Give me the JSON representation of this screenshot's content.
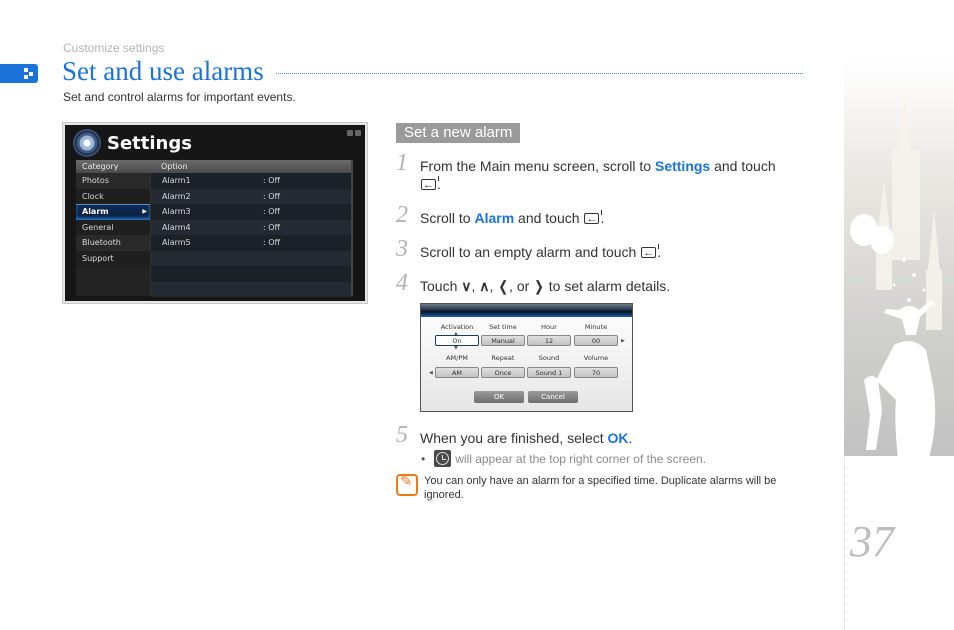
{
  "breadcrumb": "Customize settings",
  "title": "Set and use alarms",
  "subtitle": "Set and control alarms for important events.",
  "colors": {
    "accent": "#1a73d9",
    "note": "#ec7b1e",
    "badge": "#9a9a9a"
  },
  "settings_screen": {
    "title": "Settings",
    "category_header": "Category",
    "option_header": "Option",
    "categories": [
      "Photos",
      "Clock",
      "Alarm",
      "General",
      "Bluetooth",
      "Support"
    ],
    "selected_category": "Alarm",
    "options": [
      {
        "name": "Alarm1",
        "value": ": Off"
      },
      {
        "name": "Alarm2",
        "value": ": Off"
      },
      {
        "name": "Alarm3",
        "value": ": Off"
      },
      {
        "name": "Alarm4",
        "value": ": Off"
      },
      {
        "name": "Alarm5",
        "value": ": Off"
      }
    ]
  },
  "section": {
    "badge": "Set a new alarm",
    "steps": [
      {
        "num": "1",
        "pre": "From the Main menu screen, scroll to ",
        "hl": "Settings",
        "post": " and touch",
        "end": "."
      },
      {
        "num": "2",
        "pre": "Scroll to ",
        "hl": "Alarm",
        "post": " and touch ",
        "end": "."
      },
      {
        "num": "3",
        "pre": "Scroll to an empty alarm and touch ",
        "end": "."
      },
      {
        "num": "4",
        "pre": "Touch ",
        "glyphs": [
          "∨",
          "∧",
          "❬",
          "❭"
        ],
        "sep1": ", ",
        "sep2": ", ",
        "sep3": ", or ",
        "post": " to set alarm details."
      },
      {
        "num": "5",
        "pre": "When you are finished, select ",
        "hl": "OK",
        "end": "."
      }
    ],
    "bullet": "will appear at the top right corner of the screen.",
    "note": "You can only have an alarm for a specified time. Duplicate alarms will be ignored."
  },
  "alarm_dialog": {
    "row1": [
      {
        "label": "Activation",
        "value": "On"
      },
      {
        "label": "Set time",
        "value": "Manual"
      },
      {
        "label": "Hour",
        "value": "12"
      },
      {
        "label": "Minute",
        "value": "00"
      }
    ],
    "row2": [
      {
        "label": "AM/PM",
        "value": "AM"
      },
      {
        "label": "Repeat",
        "value": "Once"
      },
      {
        "label": "Sound",
        "value": "Sound 1"
      },
      {
        "label": "Volume",
        "value": "70"
      }
    ],
    "ok": "OK",
    "cancel": "Cancel"
  },
  "page_number": "37"
}
